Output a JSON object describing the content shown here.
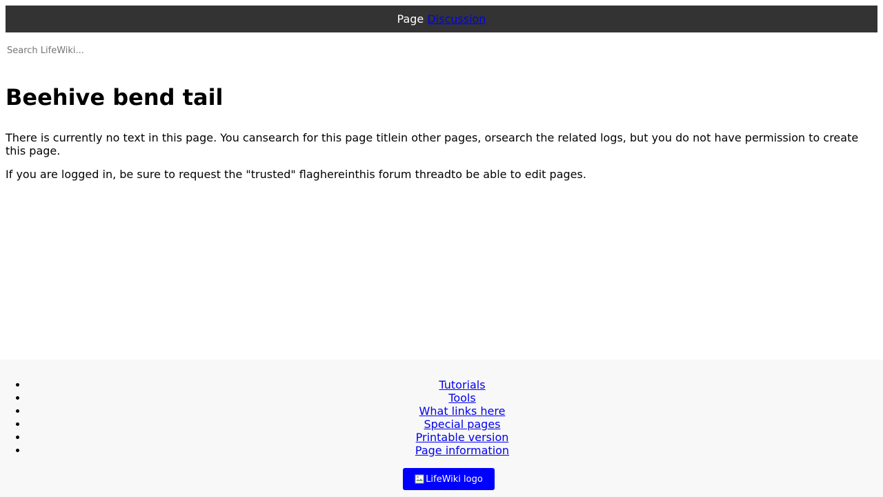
{
  "topbar": {
    "page_tab": "Page",
    "discussion_tab": "Discussion"
  },
  "search": {
    "placeholder": "Search LifeWiki..."
  },
  "main": {
    "title": "Beehive bend tail",
    "paragraph1": "There is currently no text in this page. You cansearch for this page titlein other pages, orsearch the related logs, but you do not have permission to create this page.",
    "paragraph2": "If you are logged in, be sure to request the \"trusted\" flaghereinthis forum threadto be able to edit pages."
  },
  "footer": {
    "links": [
      "Tutorials",
      "Tools",
      "What links here",
      "Special pages",
      "Printable version",
      "Page information"
    ],
    "logo_alt": "LifeWiki logo",
    "logo_button_color": "#0000ff"
  },
  "colors": {
    "topbar_bg": "#333333",
    "link": "#0000ee",
    "footer_bg": "#f8f8f8"
  }
}
